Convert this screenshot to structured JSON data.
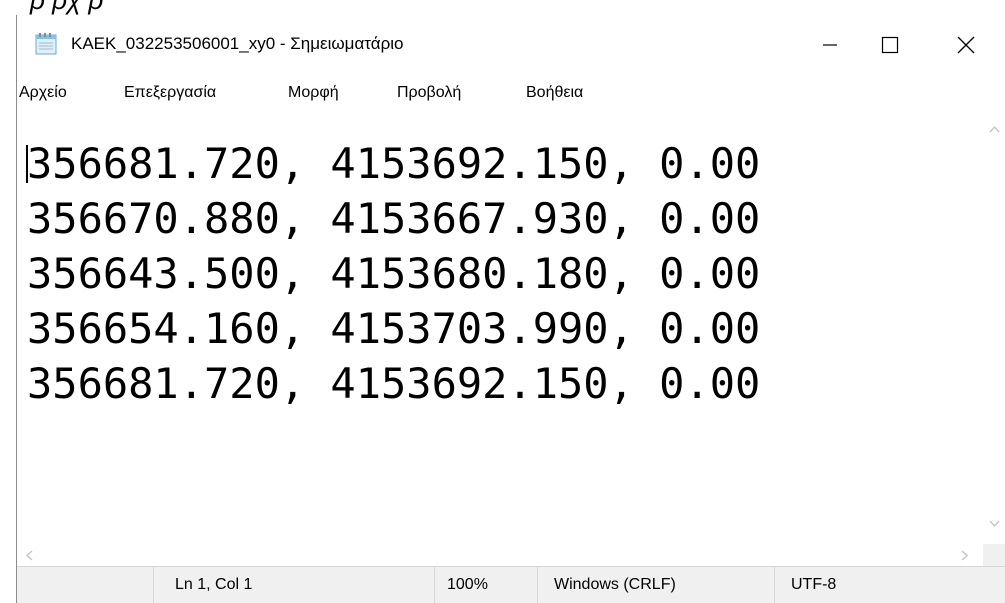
{
  "page_strip": {
    "partial_text": "ρ         ρχ                    ρ"
  },
  "window": {
    "title": "KAEK_032253506001_xy0 - Σημειωματάριο",
    "app_icon": "notepad-icon",
    "caption_buttons": {
      "minimize_icon": "minimize-icon",
      "maximize_icon": "maximize-icon",
      "close_icon": "close-icon"
    }
  },
  "menubar": {
    "items": [
      "Αρχείο",
      "Επεξεργασία",
      "Μορφή",
      "Προβολή",
      "Βοήθεια"
    ]
  },
  "editor": {
    "lines": [
      "356681.720, 4153692.150, 0.00",
      "356670.880, 4153667.930, 0.00",
      "356643.500, 4153680.180, 0.00",
      "356654.160, 4153703.990, 0.00",
      "356681.720, 4153692.150, 0.00"
    ]
  },
  "scrollbars": {
    "up_icon": "scroll-up-arrow-icon",
    "down_icon": "scroll-down-arrow-icon",
    "left_icon": "scroll-left-arrow-icon",
    "right_icon": "scroll-right-arrow-icon"
  },
  "statusbar": {
    "position": "Ln 1, Col 1",
    "zoom": "100%",
    "line_ending": "Windows (CRLF)",
    "encoding": "UTF-8"
  },
  "colors": {
    "window_bg": "#ffffff",
    "statusbar_bg": "#f0f0f0",
    "border": "#d7d7d7",
    "text": "#000000",
    "scroll_arrow": "#c4c4c4"
  }
}
